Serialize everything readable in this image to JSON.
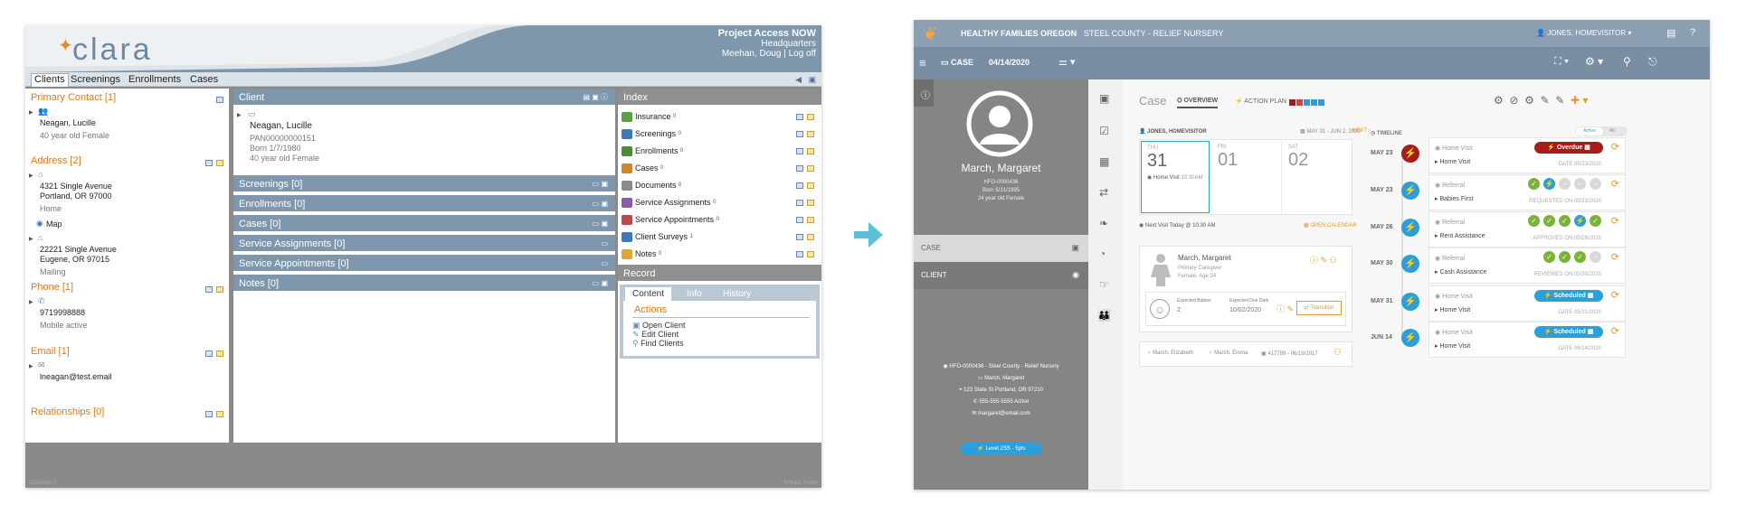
{
  "clara": {
    "brand": "clara",
    "user": {
      "project": "Project Access NOW",
      "location": "Headquarters",
      "name": "Meehan, Doug",
      "separator": "|",
      "logout": "Log off"
    },
    "tabs": [
      "Clients",
      "Screenings",
      "Enrollments",
      "Cases"
    ],
    "left": {
      "primary_contact": "Primary Contact [1]",
      "contact_name": "Neagan, Lucille",
      "contact_desc": "40 year old Female",
      "address": "Address [2]",
      "addr1_line1": "4321 Single Avenue",
      "addr1_line2": "Portland, OR 97000",
      "addr1_type": "Home",
      "map": "Map",
      "addr2_line1": "22221 Single Avenue",
      "addr2_line2": "Eugene, OR 97015",
      "addr2_type": "Mailing",
      "phone": "Phone [1]",
      "phone_number": "9719998888",
      "phone_status": "Mobile active",
      "email": "Email [1]",
      "email_value": "lneagan@test.email",
      "relationships": "Relationships [0]"
    },
    "client": {
      "header": "Client",
      "name": "Neagan, Lucille",
      "pan": "PAN00000000151",
      "born": "Born 1/7/1980",
      "desc": "40 year old Female",
      "bars": [
        "Screenings [0]",
        "Enrollments [0]",
        "Cases [0]",
        "Service Assignments [0]",
        "Service Appointments [0]",
        "Notes [0]"
      ]
    },
    "index": {
      "header": "Index",
      "items": [
        {
          "label": "Insurance",
          "count": "0",
          "color": "#5aa04a"
        },
        {
          "label": "Screenings",
          "count": "0",
          "color": "#3d77b8"
        },
        {
          "label": "Enrollments",
          "count": "0",
          "color": "#4a8c3a"
        },
        {
          "label": "Cases",
          "count": "0",
          "color": "#c98a2a"
        },
        {
          "label": "Documents",
          "count": "0",
          "color": "#8a8a8a"
        },
        {
          "label": "Service Assignments",
          "count": "0",
          "color": "#8a5aa8"
        },
        {
          "label": "Service Appointments",
          "count": "0",
          "color": "#b84a4a"
        },
        {
          "label": "Client Surveys",
          "count": "1",
          "color": "#3d77b8"
        },
        {
          "label": "Notes",
          "count": "0",
          "color": "#d9a640"
        }
      ]
    },
    "record": {
      "header": "Record",
      "tabs": [
        "Content",
        "Info",
        "History"
      ],
      "actions_title": "Actions",
      "actions": [
        "Open Client",
        "Edit Client",
        "Find Clients"
      ]
    },
    "footer_left": "Catalogic ©",
    "footer_right": "Privacy Policy"
  },
  "hfo": {
    "org_bold": "HEALTHY FAMILIES OREGON",
    "org_rest": "STEEL COUNTY - RELIEF NURSERY",
    "user": "JONES, HOMEVISITOR",
    "case_label": "CASE",
    "case_date": "04/14/2020",
    "profile": {
      "name": "March, Margaret",
      "id": "HFO-0000436",
      "born": "Born 5/21/1995",
      "desc": "24 year old Female",
      "case_item": "CASE",
      "client_item": "CLIENT",
      "detail_id": "HFO-0000436 - Steel County - Relief Nursery",
      "detail_name": "March, Margaret",
      "detail_address": "123 State St Portland, OR 97210",
      "detail_phone": "555-555-5555 Active",
      "detail_email": "margaret@email.com",
      "level": "Level 2SS - 5pts"
    },
    "case_title": "Case",
    "tabs": {
      "overview": "OVERVIEW",
      "action_plan": "ACTION PLAN"
    },
    "action_plan_colors": [
      "#a71b1b",
      "#d94040",
      "#2a9fd8",
      "#2a9fd8",
      "#2a9fd8"
    ],
    "calendar": {
      "owner": "JONES, HOMEVISITOR",
      "range": "MAY 31 - JUN 2, 2020",
      "next": "NEXT",
      "days": [
        {
          "dow": "THU",
          "num": "31",
          "event": "Home Visit",
          "time": "10:30AM"
        },
        {
          "dow": "FRI",
          "num": "01"
        },
        {
          "dow": "SAT",
          "num": "02"
        }
      ],
      "next_visit": "Next Visit Today @ 10:30 AM",
      "open_calendar": "OPEN CALENDAR"
    },
    "caregiver": {
      "name": "March, Margaret",
      "role": "Primary Caregiver",
      "desc": "Female, Age 24",
      "babies_label": "Expected Babies",
      "babies_value": "2",
      "due_label": "Expected Due Date",
      "due_value": "10/02/2020",
      "transition": "Transition"
    },
    "family": [
      "March, Elizabeth",
      "March, Emma",
      "417789 - 06/19/2017"
    ],
    "timeline": {
      "title": "TIMELINE",
      "toggle_active": "Active",
      "toggle_all": "All",
      "rows": [
        {
          "date": "MAY 23",
          "title": "Home Visit",
          "sub": "Home Visit",
          "status": "Overdue",
          "meta": "DATE 05/23/2020",
          "kind": "pill-red"
        },
        {
          "date": "MAY 23",
          "title": "Referral",
          "sub": "Babies First",
          "meta": "REQUESTED ON 05/23/2020",
          "dots": [
            "g",
            "b",
            "x",
            "x",
            "x"
          ]
        },
        {
          "date": "MAY 26",
          "title": "Referral",
          "sub": "Rent Assistance",
          "meta": "APPROVED ON 05/26/2020",
          "dots": [
            "g",
            "g",
            "g",
            "b",
            "g"
          ]
        },
        {
          "date": "MAY 30",
          "title": "Referral",
          "sub": "Cash Assistance",
          "meta": "REVIEWED ON 05/30/2020",
          "dots": [
            "g",
            "g",
            "g",
            "x"
          ]
        },
        {
          "date": "MAY 31",
          "title": "Home Visit",
          "sub": "Home Visit",
          "status": "Scheduled",
          "meta": "DATE 05/31/2020",
          "kind": "pill-blue"
        },
        {
          "date": "JUN 14",
          "title": "Home Visit",
          "sub": "Home Visit",
          "status": "Scheduled",
          "meta": "DATE 06/14/2020",
          "kind": "pill-blue"
        }
      ]
    }
  }
}
